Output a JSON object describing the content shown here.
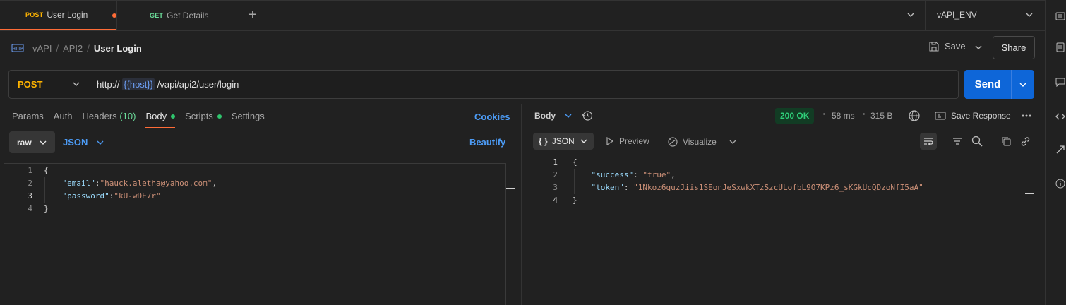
{
  "tabs": [
    {
      "method": "POST",
      "label": "User Login",
      "active": true,
      "unsaved": true
    },
    {
      "method": "GET",
      "label": "Get Details",
      "active": false,
      "unsaved": false
    }
  ],
  "environment": {
    "selected": "vAPI_ENV"
  },
  "breadcrumb": {
    "items": [
      "vAPI",
      "API2"
    ],
    "current": "User Login"
  },
  "toolbar": {
    "save_label": "Save",
    "share_label": "Share"
  },
  "request": {
    "method": "POST",
    "url_prefix": "http://",
    "url_variable": "{{host}}",
    "url_suffix": "/vapi/api2/user/login",
    "send_label": "Send"
  },
  "request_tabs": {
    "params": "Params",
    "auth": "Auth",
    "headers": "Headers",
    "headers_count": "(10)",
    "body": "Body",
    "scripts": "Scripts",
    "settings": "Settings",
    "cookies": "Cookies"
  },
  "body_options": {
    "mode": "raw",
    "language": "JSON",
    "beautify_label": "Beautify"
  },
  "request_body": {
    "line_numbers": [
      "1",
      "2",
      "3",
      "4"
    ],
    "open_brace": "{",
    "close_brace": "}",
    "email_key": "\"email\"",
    "email_value": "\"hauck.aletha@yahoo.com\"",
    "password_key": "\"password\"",
    "password_value": "\"kU-wDE7r\""
  },
  "response": {
    "body_label": "Body",
    "status": "200 OK",
    "time": "58 ms",
    "size": "315 B",
    "save_response_label": "Save Response",
    "format_braces": "{ }",
    "format_label": "JSON",
    "preview_label": "Preview",
    "visualize_label": "Visualize",
    "line_numbers": [
      "1",
      "2",
      "3",
      "4"
    ],
    "open_brace": "{",
    "close_brace": "}",
    "success_key": "\"success\"",
    "success_value": "\"true\"",
    "token_key": "\"token\"",
    "token_value": "\"1Nkoz6quzJiis1SEonJeSxwkXTzSzcULofbL9O7KPz6_sKGkUcQDzoNfI5aA\""
  },
  "colors": {
    "accent_orange": "#ff6c37",
    "post_method": "#ffb400",
    "get_method": "#6bdd9a",
    "send_button": "#0e66d8",
    "link_blue": "#4c9bf5",
    "status_green": "#2fd07a"
  }
}
